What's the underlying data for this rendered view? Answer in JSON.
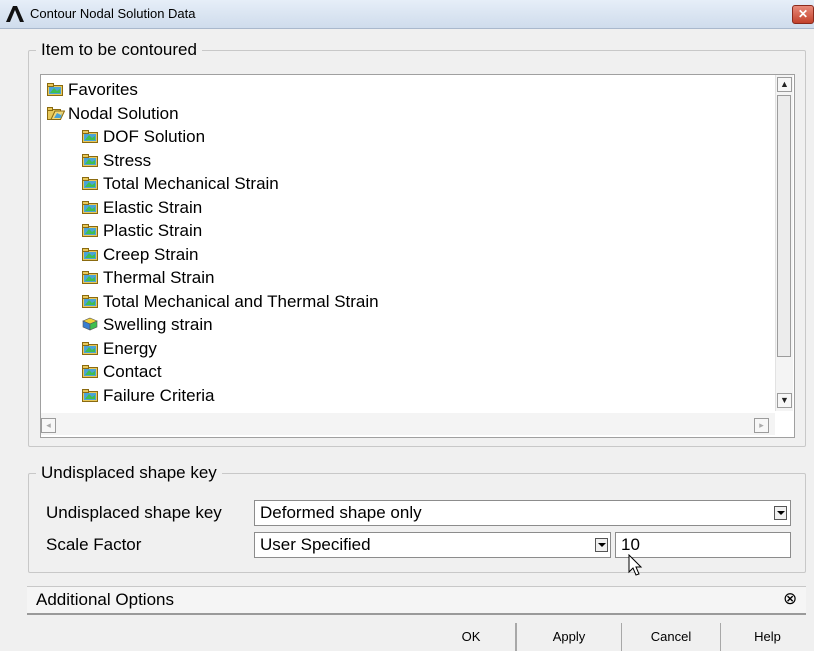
{
  "window": {
    "title": "Contour Nodal Solution Data",
    "close_glyph": "✕"
  },
  "item_group": {
    "legend": "Item to be contoured",
    "tree": [
      {
        "label": "Favorites",
        "icon": "folder-icon",
        "level": 0
      },
      {
        "label": "Nodal Solution",
        "icon": "open-folder-icon",
        "level": 0
      },
      {
        "label": "DOF Solution",
        "icon": "folder-icon",
        "level": 1
      },
      {
        "label": "Stress",
        "icon": "folder-icon",
        "level": 1
      },
      {
        "label": "Total Mechanical Strain",
        "icon": "folder-icon",
        "level": 1
      },
      {
        "label": "Elastic Strain",
        "icon": "folder-icon",
        "level": 1
      },
      {
        "label": "Plastic Strain",
        "icon": "folder-icon",
        "level": 1
      },
      {
        "label": "Creep Strain",
        "icon": "folder-icon",
        "level": 1
      },
      {
        "label": "Thermal Strain",
        "icon": "folder-icon",
        "level": 1
      },
      {
        "label": "Total Mechanical and Thermal Strain",
        "icon": "folder-icon",
        "level": 1
      },
      {
        "label": "Swelling strain",
        "icon": "cube-icon",
        "level": 1
      },
      {
        "label": "Energy",
        "icon": "folder-icon",
        "level": 1
      },
      {
        "label": "Contact",
        "icon": "folder-icon",
        "level": 1
      },
      {
        "label": "Failure Criteria",
        "icon": "folder-icon",
        "level": 1
      }
    ]
  },
  "shape_group": {
    "legend": "Undisplaced shape key",
    "shape_key_label": "Undisplaced shape key",
    "shape_key_value": "Deformed shape only",
    "scale_label": "Scale Factor",
    "scale_mode_value": "User Specified",
    "scale_value": "10"
  },
  "additional": {
    "label": "Additional Options",
    "toggle_glyph": "⊗"
  },
  "buttons": {
    "ok": "OK",
    "apply": "Apply",
    "cancel": "Cancel",
    "help": "Help"
  },
  "colors": {
    "accent_close": "#c2412b",
    "tree_bg": "#ffffff",
    "window_bg": "#f0f0f0"
  }
}
